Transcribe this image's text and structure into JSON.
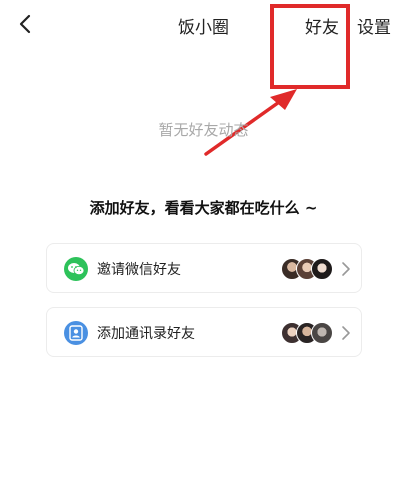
{
  "header": {
    "back_icon": "chevron-left-icon",
    "title": "饭小圈",
    "friends_label": "好友",
    "settings_label": "设置"
  },
  "annotation": {
    "color": "#e02a2a"
  },
  "empty_state": {
    "text": "暂无好友动态"
  },
  "invite": {
    "heading": "添加好友，看看大家都在吃什么 ~",
    "options": [
      {
        "label": "邀请微信好友",
        "icon": "wechat-icon",
        "icon_color": "#2dc25a"
      },
      {
        "label": "添加通讯录好友",
        "icon": "contacts-icon",
        "icon_color": "#4a90e2"
      }
    ]
  }
}
